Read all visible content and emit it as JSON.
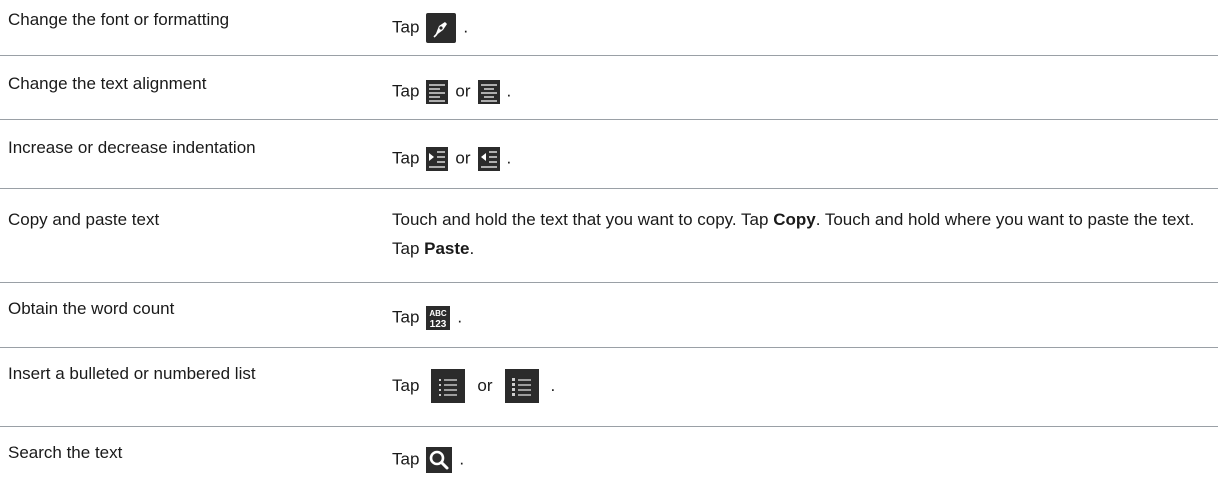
{
  "rows": [
    {
      "task": "Change the font or formatting",
      "tap": "Tap",
      "icons": [
        "pen-formatting-icon"
      ],
      "end": "."
    },
    {
      "task": "Change the text alignment",
      "tap": "Tap",
      "icons": [
        "align-left-icon",
        "align-center-icon"
      ],
      "or": "or",
      "end": "."
    },
    {
      "task": "Increase or decrease indentation",
      "tap": "Tap",
      "icons": [
        "indent-increase-icon",
        "indent-decrease-icon"
      ],
      "or": "or",
      "end": "."
    },
    {
      "task": "Copy and paste text",
      "action_parts": [
        "Touch and hold the text that you want to copy. Tap ",
        "Copy",
        ". Touch and hold where you want to paste the text. Tap ",
        "Paste",
        "."
      ]
    },
    {
      "task": "Obtain the word count",
      "tap": "Tap",
      "icons": [
        "word-count-icon"
      ],
      "end": "."
    },
    {
      "task": "Insert a bulleted or numbered list",
      "tap": "Tap",
      "icons": [
        "bulleted-list-icon",
        "numbered-list-icon"
      ],
      "or": "or",
      "end": "."
    },
    {
      "task": "Search the text",
      "tap": "Tap",
      "icons": [
        "search-icon"
      ],
      "end": "."
    }
  ],
  "icon_glyphs": {
    "word_count_top": "ABC",
    "word_count_bottom": "123"
  },
  "colors": {
    "rule": "#9aa0a6",
    "icon_bg": "#2b2b2b",
    "icon_fg": "#ffffff",
    "text": "#1a1a1a"
  }
}
